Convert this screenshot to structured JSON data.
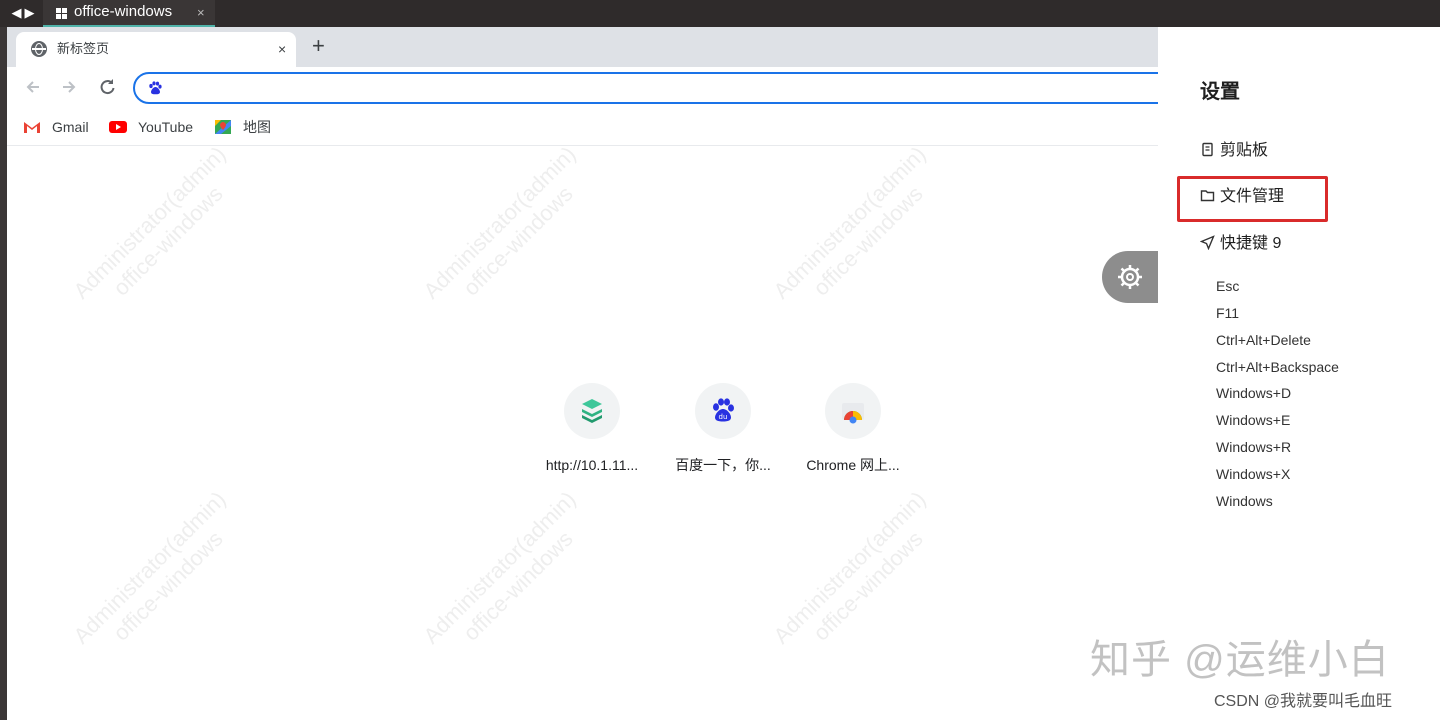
{
  "remote_tab": {
    "title": "office-windows",
    "close": "×"
  },
  "browser": {
    "tab": {
      "title": "新标签页",
      "close": "×"
    },
    "new_tab": "+",
    "bookmarks": [
      {
        "label": "Gmail",
        "icon": "gmail-icon"
      },
      {
        "label": "YouTube",
        "icon": "youtube-icon"
      },
      {
        "label": "地图",
        "icon": "maps-icon"
      }
    ],
    "shortcuts": [
      {
        "label": "http://10.1.11...",
        "icon": "stack-icon"
      },
      {
        "label": "百度一下，你...",
        "icon": "baidu-icon"
      },
      {
        "label": "Chrome 网上...",
        "icon": "chrome-webstore-icon"
      }
    ],
    "watermark": {
      "line1": "Administrator(admin)",
      "line2": "office-windows"
    }
  },
  "settings": {
    "title": "设置",
    "clipboard": "剪贴板",
    "file_manager": "文件管理",
    "shortcuts_label": "快捷键 9",
    "keys": [
      "Esc",
      "F11",
      "Ctrl+Alt+Delete",
      "Ctrl+Alt+Backspace",
      "Windows+D",
      "Windows+E",
      "Windows+R",
      "Windows+X",
      "Windows"
    ]
  },
  "credits": {
    "zhihu": "知乎 @运维小白",
    "csdn": "CSDN @我就要叫毛血旺"
  },
  "colors": {
    "accent": "#1a73e8",
    "highlight": "#d92b2b",
    "topbar": "#2f2b2b"
  }
}
